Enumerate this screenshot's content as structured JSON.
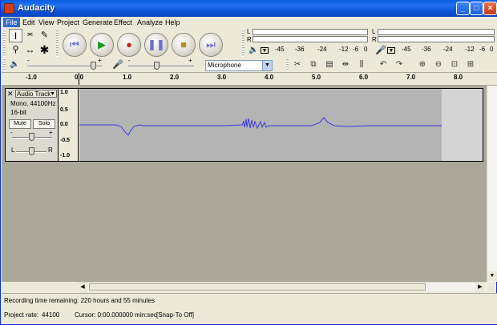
{
  "window": {
    "title": "Audacity"
  },
  "menu": [
    "File",
    "Edit",
    "View",
    "Project",
    "Generate",
    "Effect",
    "Analyze",
    "Help"
  ],
  "meters": {
    "lr_labels": [
      "L",
      "R"
    ],
    "scale": [
      "-45",
      "-36",
      "-24",
      "-12",
      "-6",
      "0"
    ]
  },
  "mixer": {
    "output_min": "-",
    "output_max": "+",
    "input_min": "-",
    "input_max": "+",
    "input_source": "Microphone"
  },
  "ruler": {
    "labels": [
      "-1.0",
      "0.0",
      "1.0",
      "2.0",
      "3.0",
      "4.0",
      "5.0",
      "6.0",
      "7.0",
      "8.0"
    ]
  },
  "track": {
    "name": "Audio Track",
    "format_line1": "Mono, 44100Hz",
    "format_line2": "16-bit",
    "mute_label": "Mute",
    "solo_label": "Solo",
    "gain_min": "-",
    "gain_max": "+",
    "pan_left": "L",
    "pan_right": "R",
    "amplitude_labels": [
      "1.0",
      "0.5",
      "0.0",
      "-0.5",
      "-1.0"
    ]
  },
  "status": {
    "message": "Recording time remaining: 220 hours and 55 minutes",
    "project_rate_label": "Project rate:",
    "project_rate_value": "44100",
    "cursor_label": "Cursor: 0:00.000000 min:sec",
    "snap_label": "[Snap-To Off]"
  },
  "colors": {
    "waveform": "#3c3cdc",
    "waveform_bg": "#b4b4b4",
    "titlebar": "#0b53d3",
    "menu_highlight": "#316ac5"
  }
}
